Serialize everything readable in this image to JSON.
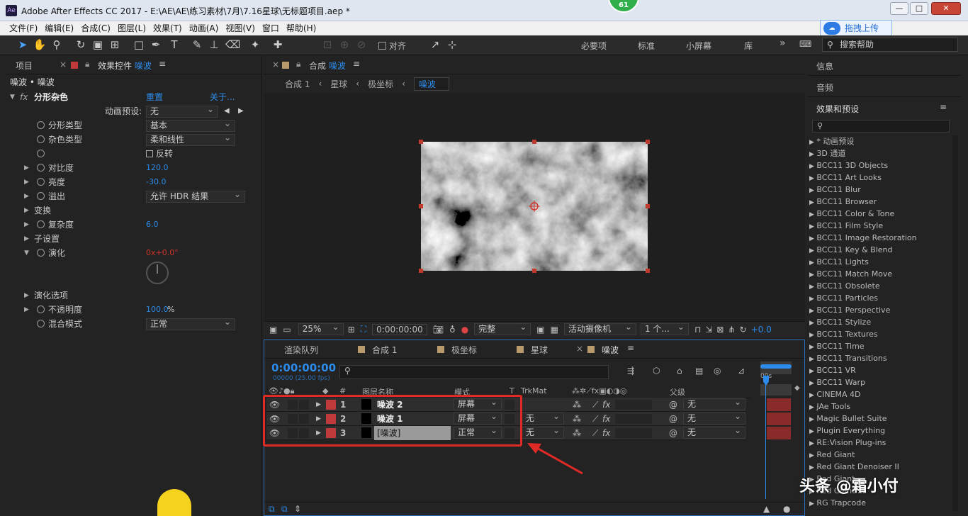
{
  "window": {
    "title": "Adobe After Effects CC 2017 - E:\\AE\\AE\\练习素材\\7月\\7.16星球\\无标题项目.aep *",
    "badge": "61",
    "logo": "Ae",
    "minimize": "—",
    "maximize": "□",
    "close": "✕",
    "upload": "拖拽上传"
  },
  "menu": [
    "文件(F)",
    "编辑(E)",
    "合成(C)",
    "图层(L)",
    "效果(T)",
    "动画(A)",
    "视图(V)",
    "窗口",
    "帮助(H)"
  ],
  "toolbar": {
    "snap_label": "对齐",
    "workspaces": [
      "必要项",
      "标准",
      "小屏幕",
      "库"
    ],
    "more": "»",
    "search_placeholder": "搜索帮助"
  },
  "left": {
    "tab_project": "项目",
    "tab_effects_prefix": "效果控件",
    "tab_effects_layer": "噪波",
    "breadcrumb": "噪波 • 噪波",
    "effect_name": "分形杂色",
    "reset": "重置",
    "about": "关于...",
    "preset_label": "动画预设:",
    "preset_value": "无",
    "props": [
      {
        "label": "分形类型",
        "value": "基本",
        "kind": "dd"
      },
      {
        "label": "杂色类型",
        "value": "柔和线性",
        "kind": "dd"
      },
      {
        "label": "",
        "value": "反转",
        "kind": "check"
      },
      {
        "label": "对比度",
        "value": "120.0",
        "kind": "num"
      },
      {
        "label": "亮度",
        "value": "-30.0",
        "kind": "num"
      },
      {
        "label": "溢出",
        "value": "允许 HDR 结果",
        "kind": "dd"
      },
      {
        "label": "变换",
        "value": "",
        "kind": "group"
      },
      {
        "label": "复杂度",
        "value": "6.0",
        "kind": "num"
      },
      {
        "label": "子设置",
        "value": "",
        "kind": "group"
      },
      {
        "label": "演化",
        "value": "",
        "kind": "evol"
      }
    ],
    "evolution": {
      "rev": "0x",
      "deg": "+0.0°"
    },
    "props2": [
      {
        "label": "演化选项",
        "value": "",
        "kind": "group"
      },
      {
        "label": "不透明度",
        "value": "100.0",
        "unit": "%",
        "kind": "num"
      },
      {
        "label": "混合模式",
        "value": "正常",
        "kind": "dd"
      }
    ]
  },
  "comp": {
    "tab_label": "合成",
    "tab_name": "噪波",
    "crumbs": [
      "合成 1",
      "星球",
      "极坐标",
      "噪波"
    ],
    "bottom": {
      "zoom": "25%",
      "time": "0:00:00:00",
      "quality": "完整",
      "camera": "活动摄像机",
      "views": "1 个...",
      "exposure": "+0.0"
    }
  },
  "right": {
    "info": "信息",
    "audio": "音频",
    "effects_title": "效果和预设",
    "search_placeholder": "",
    "effects": [
      "* 动画预设",
      "3D 通道",
      "BCC11 3D Objects",
      "BCC11 Art Looks",
      "BCC11 Blur",
      "BCC11 Browser",
      "BCC11 Color & Tone",
      "BCC11 Film Style",
      "BCC11 Image Restoration",
      "BCC11 Key & Blend",
      "BCC11 Lights",
      "BCC11 Match Move",
      "BCC11 Obsolete",
      "BCC11 Particles",
      "BCC11 Perspective",
      "BCC11 Stylize",
      "BCC11 Textures",
      "BCC11 Time",
      "BCC11 Transitions",
      "BCC11 VR",
      "BCC11 Warp",
      "CINEMA 4D",
      "JAe Tools",
      "Magic Bullet Suite",
      "Plugin Everything",
      "RE:Vision Plug-ins",
      "Red Giant",
      "Red Giant Denoiser II",
      "Red Giant ...",
      "Red Giant ...",
      "RG Trapcode"
    ]
  },
  "timeline": {
    "tabs": [
      "渲染队列",
      "合成 1",
      "极坐标",
      "星球",
      "噪波"
    ],
    "timecode": "0:00:00:00",
    "fps": "00000 (25.00 fps)",
    "ruler_start": "00s",
    "headers": {
      "num": "#",
      "name": "图层名称",
      "mode": "模式",
      "t": "T",
      "trkmat": "TrkMat",
      "parent": "父级"
    },
    "layers": [
      {
        "num": "1",
        "name": "噪波 2",
        "mode": "屏幕",
        "trkmat": "",
        "parent": "无"
      },
      {
        "num": "2",
        "name": "噪波 1",
        "mode": "屏幕",
        "trkmat": "无",
        "parent": "无"
      },
      {
        "num": "3",
        "name": "[噪波]",
        "mode": "正常",
        "trkmat": "无",
        "parent": "无"
      }
    ]
  },
  "watermark": "头条 @霜小付",
  "colors": {
    "accent": "#2d8ceb",
    "label_red": "#c0393b",
    "highlight": "#e02a26"
  }
}
